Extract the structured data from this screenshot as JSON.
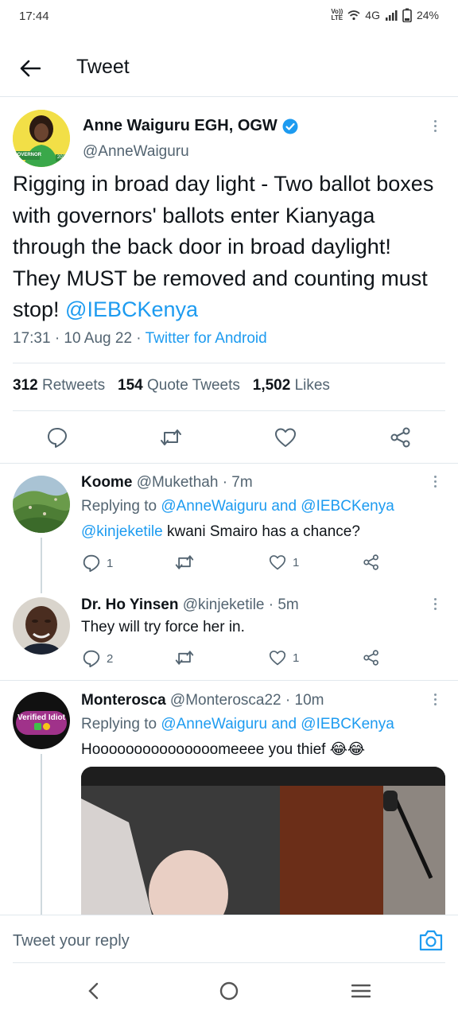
{
  "status_bar": {
    "time": "17:44",
    "network": "4G",
    "volte_top": "Vo))",
    "volte_bottom": "LTE",
    "battery": "24%"
  },
  "header": {
    "title": "Tweet"
  },
  "tweet": {
    "author_name": "Anne Waiguru EGH, OGW",
    "author_handle": "@AnneWaiguru",
    "avatar_badge": "GOVERNOR",
    "avatar_year": "2022",
    "text": "Rigging in broad day light - Two ballot boxes with governors' ballots enter Kianyaga through the back door in broad daylight! They MUST be removed and counting must stop! ",
    "mention": "@IEBCKenya",
    "time": "17:31 · 10 Aug 22 · ",
    "source": "Twitter for Android",
    "retweets_count": "312",
    "retweets_label": "Retweets",
    "quotes_count": "154",
    "quotes_label": "Quote Tweets",
    "likes_count": "1,502",
    "likes_label": "Likes"
  },
  "replies": [
    {
      "name": "Koome",
      "handle": "@Mukethah · 7m",
      "replying_prefix": "Replying to ",
      "replying_to": "@AnneWaiguru and @IEBCKenya",
      "mention": "@kinjeketile",
      "text": " kwani Smairo has a chance?",
      "reply_count": "1",
      "like_count": "1"
    },
    {
      "name": "Dr. Ho Yinsen",
      "handle": "@kinjeketile · 5m",
      "text": "They will try force her in.",
      "reply_count": "2",
      "like_count": "1"
    },
    {
      "name": "Monterosca",
      "handle": "@Monterosca22 · 10m",
      "avatar_text": "Verified Idiot",
      "replying_prefix": "Replying to ",
      "replying_to": "@AnneWaiguru and @IEBCKenya",
      "text": "Hooooooooooooooomeeee you thief 😂😂"
    }
  ],
  "reply_bar": {
    "placeholder": "Tweet your reply"
  },
  "colors": {
    "accent": "#1d9bf0",
    "text": "#0f1419",
    "muted": "#536471"
  }
}
